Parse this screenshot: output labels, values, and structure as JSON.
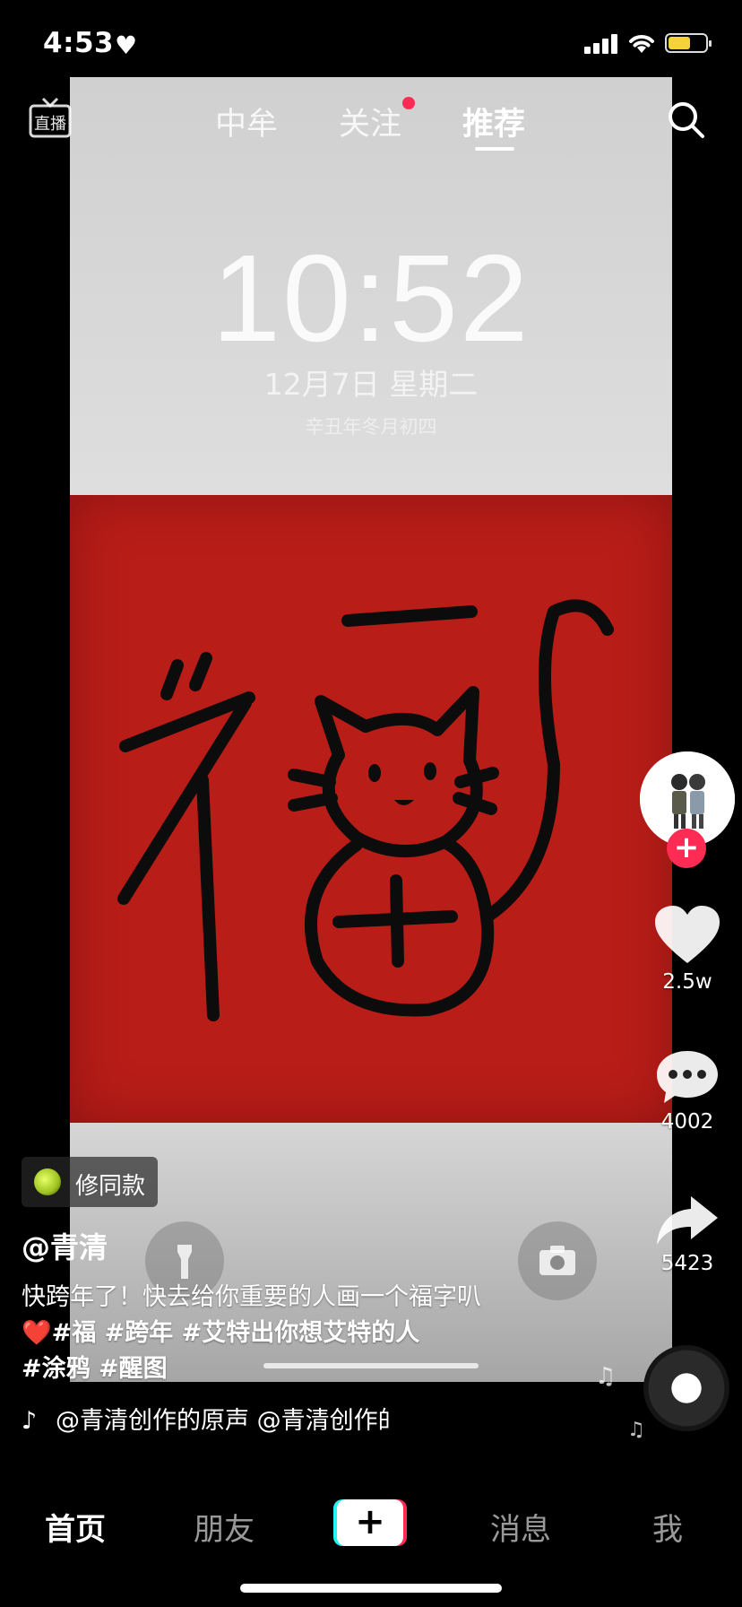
{
  "status_bar": {
    "time": "4:53",
    "heart": "♥",
    "signal_icon": "signal-bars-icon",
    "wifi_icon": "wifi-icon",
    "battery_icon": "battery-icon",
    "battery_level": 0.55,
    "battery_color": "#f6d23a"
  },
  "top_nav": {
    "live_icon_text": "直播",
    "tabs": [
      {
        "label": "中牟"
      },
      {
        "label": "关注",
        "has_dot": true
      },
      {
        "label": "推荐",
        "active": true
      }
    ],
    "search_icon": "search-icon"
  },
  "video": {
    "lock_time": "10:52",
    "lock_date": "12月7日 星期二",
    "lock_lunar": "辛丑年冬月初四",
    "poster_character": "福",
    "poster_color": "#b91d18"
  },
  "actions": {
    "follow_plus": "+",
    "like_count": "2.5w",
    "comment_count": "4002",
    "share_count": "5423",
    "accent": "#fe2c55"
  },
  "post": {
    "tag_chip": "修同款",
    "username": "@青清",
    "caption_line1": "快跨年了！快去给你重要的人画一个福字叭",
    "caption_line2": "❤️#福 #跨年  #艾特出你想艾特的人",
    "caption_line3": "#涂鸦 #醒图",
    "music_icon": "♪",
    "music_text": "@青清创作的原声    @青清创作的原声"
  },
  "tab_bar": {
    "home": "首页",
    "friends": "朋友",
    "create": "+",
    "messages": "消息",
    "me": "我"
  }
}
